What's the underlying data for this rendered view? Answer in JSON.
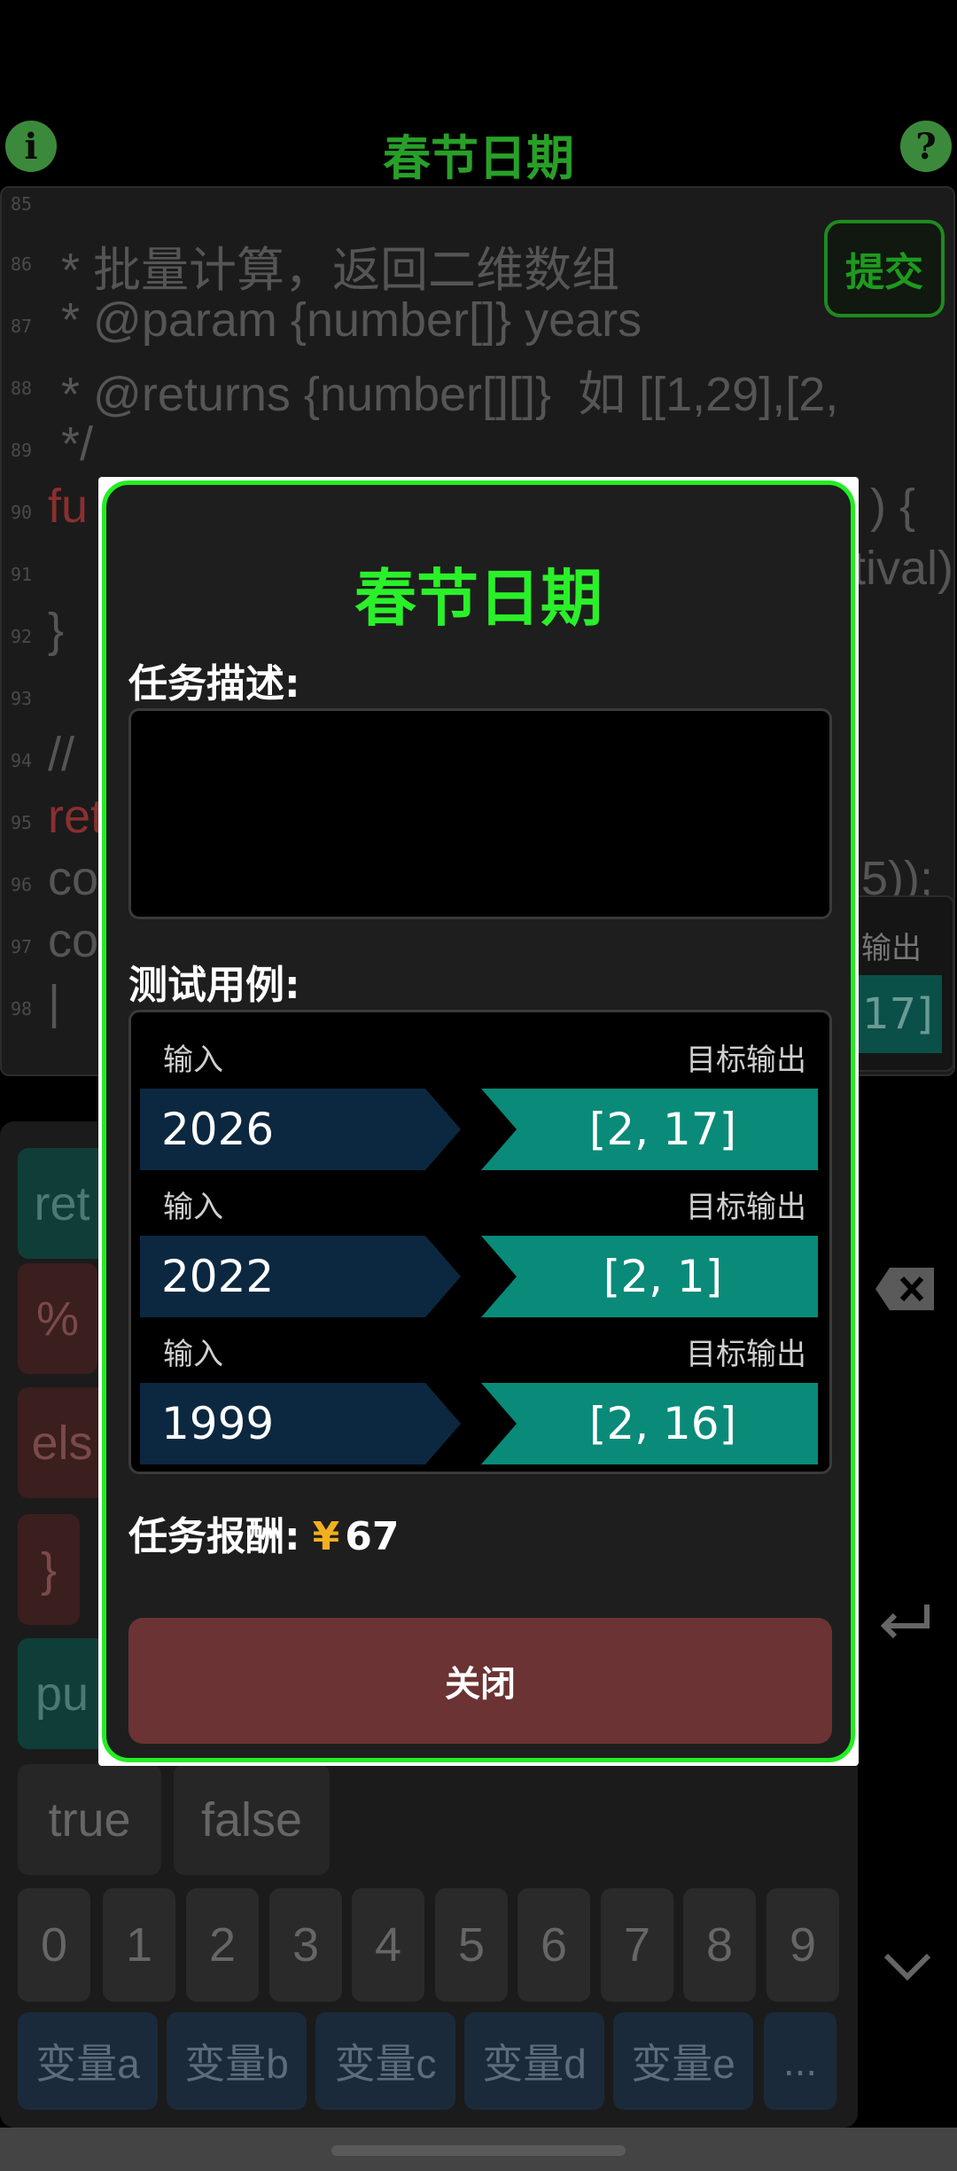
{
  "header": {
    "info_icon": "i",
    "help_icon": "?",
    "title": "春节日期"
  },
  "editor": {
    "lines": [
      {
        "n": "85",
        "text": ""
      },
      {
        "n": "86",
        "text": " * 批量计算，返回二维数组"
      },
      {
        "n": "87",
        "text": " * @param {number[]} years"
      },
      {
        "n": "88",
        "text": " * @returns {number[][]}  如 [[1,29],[2,"
      },
      {
        "n": "89",
        "text": " */"
      },
      {
        "n": "90",
        "text": "fu"
      },
      {
        "n": "91",
        "text": ""
      },
      {
        "n": "92",
        "text": "}"
      },
      {
        "n": "93",
        "text": ""
      },
      {
        "n": "94",
        "text": "//"
      },
      {
        "n": "95",
        "text": "ret"
      },
      {
        "n": "96",
        "text": "co"
      },
      {
        "n": "97",
        "text": "co"
      },
      {
        "n": "98",
        "text": "|"
      }
    ],
    "right_fragments": {
      "line90": ") {",
      "line91": "tival)",
      "line96": "5));",
      "side_label": "输出",
      "side_value": "17]"
    },
    "submit_label": "提交"
  },
  "keyboard": {
    "left_keys": [
      "ret",
      "%",
      "els",
      "}",
      "pu"
    ],
    "bool_keys": [
      "true",
      "false"
    ],
    "digits": [
      "0",
      "1",
      "2",
      "3",
      "4",
      "5",
      "6",
      "7",
      "8",
      "9"
    ],
    "vars": [
      "变量a",
      "变量b",
      "变量c",
      "变量d",
      "变量e",
      "..."
    ],
    "side_icons": [
      "backspace-icon",
      "enter-icon",
      "collapse-icon"
    ]
  },
  "dialog": {
    "title": "春节日期",
    "desc_label": "任务描述:",
    "desc_text": "",
    "cases_label": "测试用例:",
    "input_label": "输入",
    "output_label": "目标输出",
    "cases": [
      {
        "input": "2026",
        "output": "[2, 17]"
      },
      {
        "input": "2022",
        "output": "[2, 1]"
      },
      {
        "input": "1999",
        "output": "[2, 16]"
      }
    ],
    "reward_label": "任务报酬:",
    "reward_currency": "¥",
    "reward_amount": "67",
    "close_label": "关闭"
  },
  "colors": {
    "accent_green": "#22ee22",
    "input_blue": "#0c2840",
    "output_teal": "#0a8a78",
    "close_red": "#6b3333",
    "currency_gold": "#f0b020"
  }
}
